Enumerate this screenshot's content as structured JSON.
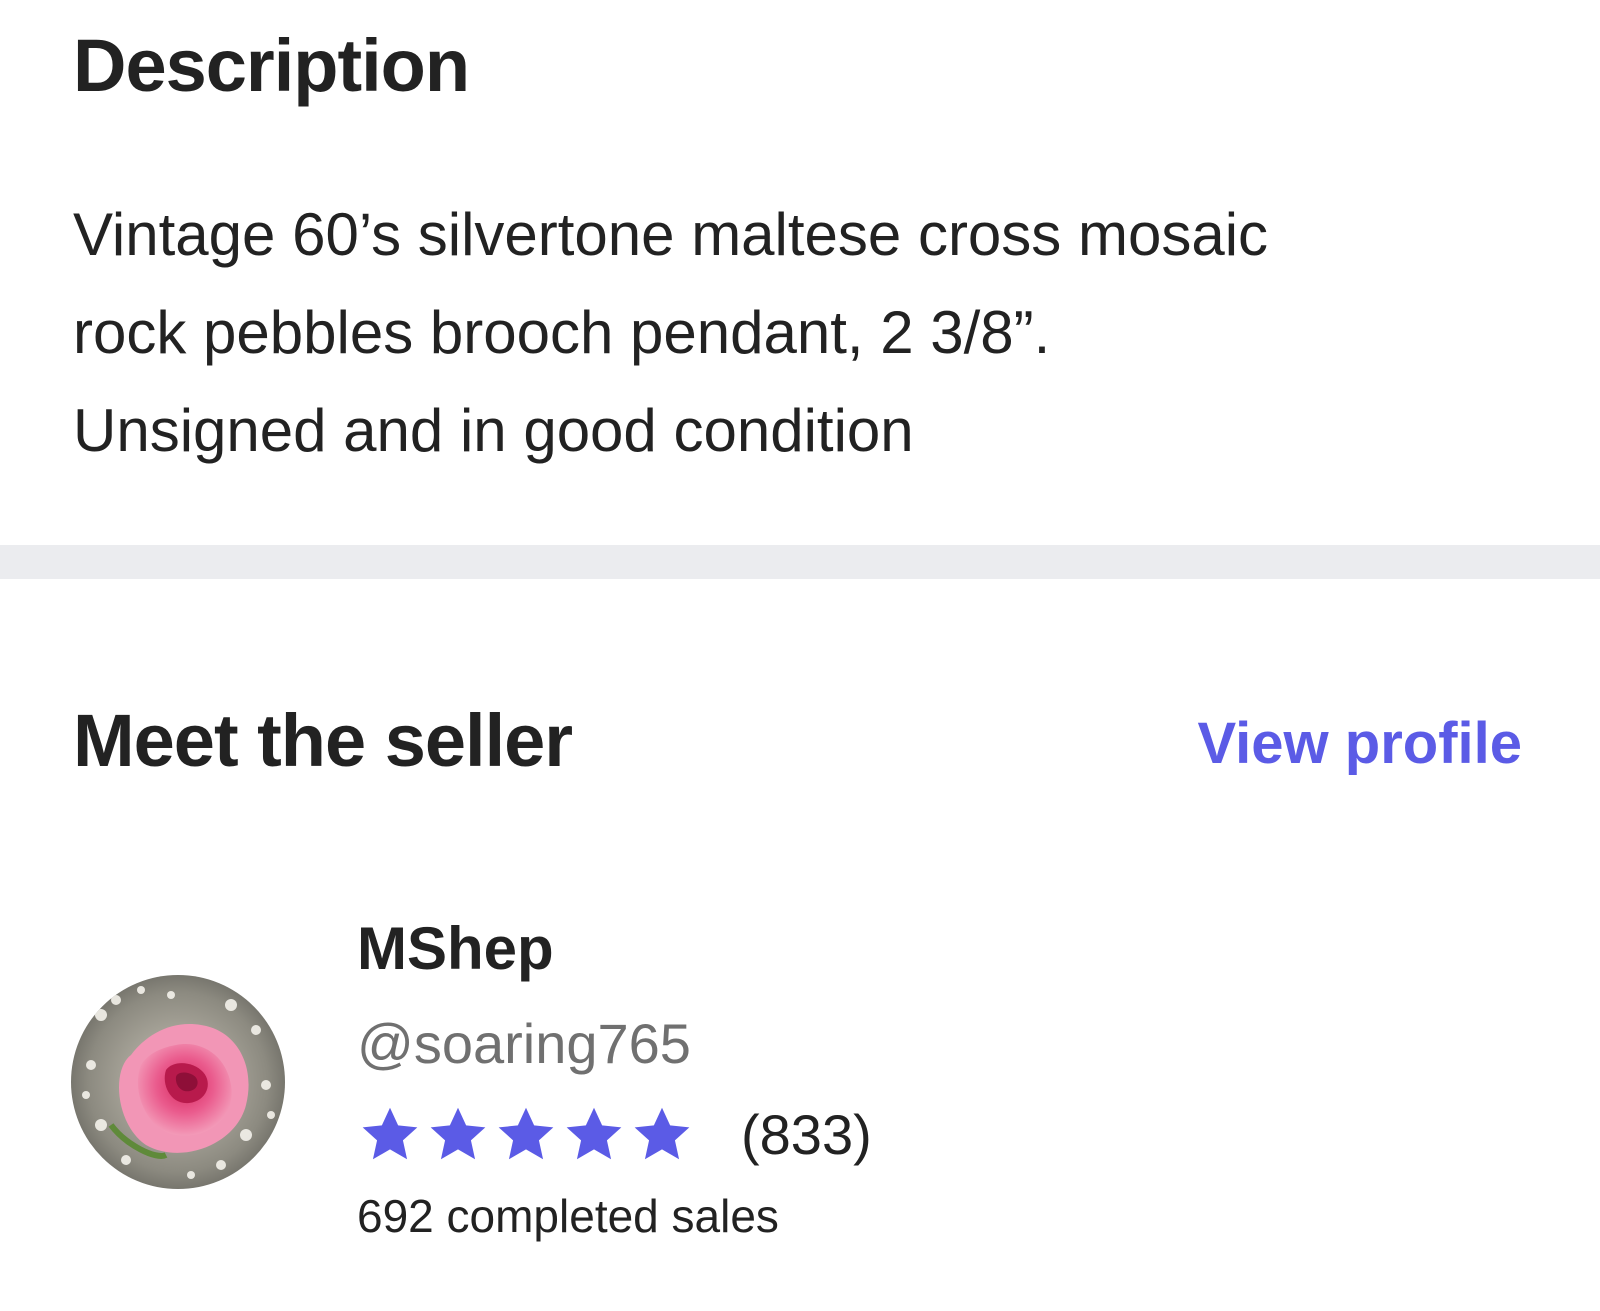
{
  "description": {
    "title": "Description",
    "lines": [
      "Vintage 60’s silvertone maltese cross mosaic",
      "rock pebbles brooch pendant, 2 3/8”.",
      "Unsigned and in good condition"
    ]
  },
  "seller": {
    "heading": "Meet the seller",
    "view_profile_label": "View profile",
    "name": "MShep",
    "handle": "@soaring765",
    "rating": {
      "stars": 5,
      "max_stars": 5,
      "review_count": "(833)",
      "star_color": "#5b5be6",
      "star_icon": "star-icon"
    },
    "completed_sales": "692 completed sales",
    "avatar_icon": "pink-rose-avatar"
  },
  "colors": {
    "accent": "#5b5be6",
    "text": "#222222",
    "muted_text": "#707070",
    "divider": "#ebecef"
  }
}
